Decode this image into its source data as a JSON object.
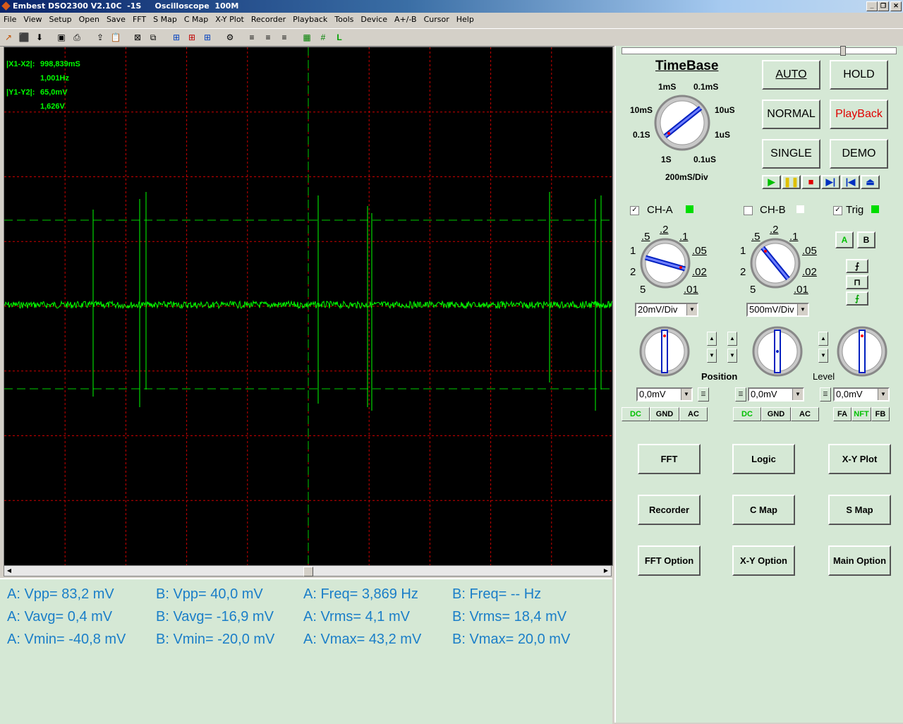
{
  "window": {
    "title": "Embest DSO2300 V2.10C  -1S     Oscilloscope  100M"
  },
  "menu": [
    "File",
    "View",
    "Setup",
    "Open",
    "Save",
    "FFT",
    "S Map",
    "C Map",
    "X-Y Plot",
    "Recorder",
    "Playback",
    "Tools",
    "Device",
    "A+/-B",
    "Cursor",
    "Help"
  ],
  "cursor_readout": {
    "dx_label": "|X1-X2|:",
    "dx": "998,839mS",
    "freq": "1,001Hz",
    "dy_label": "|Y1-Y2|:",
    "dy": "65,0mV",
    "volt": "1,626V"
  },
  "measurements": [
    [
      "A: Vpp= 83,2 mV",
      "B: Vpp= 40,0 mV",
      "A: Freq= 3,869 Hz",
      "B: Freq= -- Hz"
    ],
    [
      "A: Vavg= 0,4 mV",
      "B: Vavg= -16,9 mV",
      "A: Vrms= 4,1 mV",
      "B: Vrms= 18,4 mV"
    ],
    [
      "A: Vmin= -40,8 mV",
      "B: Vmin= -20,0 mV",
      "A: Vmax= 43,2 mV",
      "B: Vmax= 20,0 mV"
    ]
  ],
  "timebase": {
    "title": "TimeBase",
    "ticks": {
      "t1": "1mS",
      "t2": "0.1mS",
      "t3": "10mS",
      "t4": "10uS",
      "t5": "0.1S",
      "t6": "1uS",
      "t7": "1S",
      "t8": "0.1uS"
    },
    "value": "200mS/Div"
  },
  "mode_buttons": {
    "auto": "AUTO",
    "hold": "HOLD",
    "normal": "NORMAL",
    "playback": "PlayBack",
    "single": "SINGLE",
    "demo": "DEMO"
  },
  "channels": {
    "a": {
      "label": "CH-A",
      "checked": "✓",
      "volt_div": "20mV/Div",
      "offset": "0,0mV",
      "ticks": [
        ".2",
        ".5",
        ".1",
        "1",
        ".05",
        "2",
        ".02",
        "5",
        ".01"
      ],
      "coupling": [
        "DC",
        "GND",
        "AC"
      ]
    },
    "b": {
      "label": "CH-B",
      "checked": "",
      "volt_div": "500mV/Div",
      "offset": "0,0mV",
      "ticks": [
        ".2",
        ".5",
        ".1",
        "1",
        ".05",
        "2",
        ".02",
        "5",
        ".01"
      ],
      "coupling": [
        "DC",
        "GND",
        "AC"
      ]
    },
    "trig": {
      "label": "Trig",
      "checked": "✓",
      "level": "0,0mV",
      "src_a": "A",
      "src_b": "B",
      "mode": [
        "FA",
        "NFT",
        "FB"
      ]
    }
  },
  "labels": {
    "position": "Position",
    "level": "Level"
  },
  "func_buttons": {
    "fft": "FFT",
    "logic": "Logic",
    "xy": "X-Y Plot",
    "recorder": "Recorder",
    "cmap": "C Map",
    "smap": "S Map",
    "fft_opt": "FFT Option",
    "xy_opt": "X-Y Option",
    "main_opt": "Main Option"
  },
  "colors": {
    "trace": "#00ff00",
    "grid": "#cc0000",
    "cursor": "#00cc00",
    "meas_text": "#1a7ec8",
    "panel_bg": "#d5e8d5"
  }
}
